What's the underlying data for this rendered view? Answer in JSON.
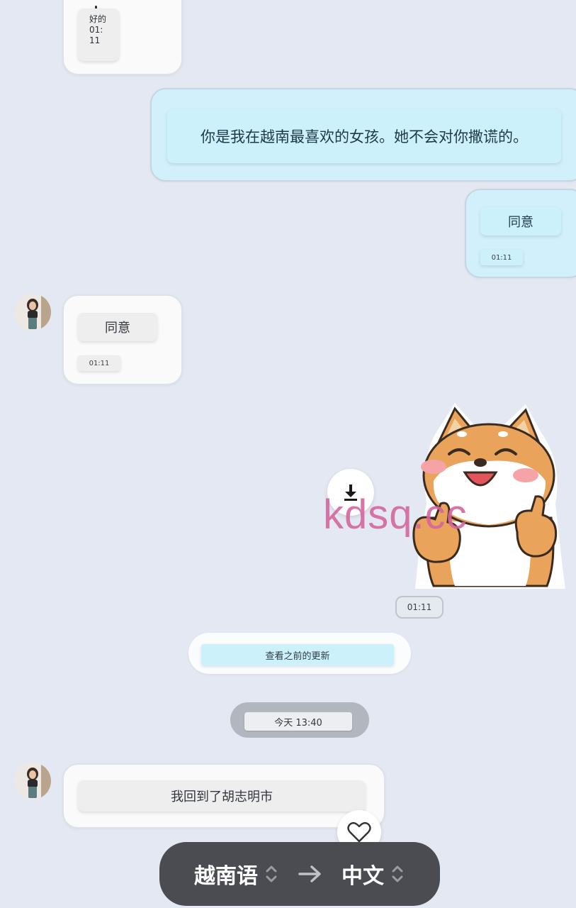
{
  "messages": {
    "top_incoming": {
      "text": "好的",
      "time": "01:11"
    },
    "outgoing_long": {
      "text": "你是我在越南最喜欢的女孩。她不会对你撒谎的。"
    },
    "outgoing_agree": {
      "text": "同意",
      "time": "01:11"
    },
    "incoming_agree": {
      "text": "同意",
      "time": "01:11"
    },
    "sticker": {
      "time": "01:11",
      "description": "shiba-inu-thumbs-up"
    },
    "incoming_last": {
      "text": "我回到了胡志明市"
    }
  },
  "view_previous_updates": "查看之前的更新",
  "date_separator": "今天 13:40",
  "watermark": "kdsq.cc",
  "translate_bar": {
    "source_lang": "越南语",
    "target_lang": "中文"
  },
  "icons": {
    "download": "download-icon",
    "heart": "heart-icon",
    "swap_arrow": "arrow-right-icon",
    "lang_chevron": "chevron-updown-icon"
  },
  "colors": {
    "background": "#e3e8f2",
    "outgoing_bubble": "#d2f0fb",
    "incoming_bubble": "#fafafa",
    "watermark": "#d4669e",
    "translate_bar": "#4a4c52"
  }
}
